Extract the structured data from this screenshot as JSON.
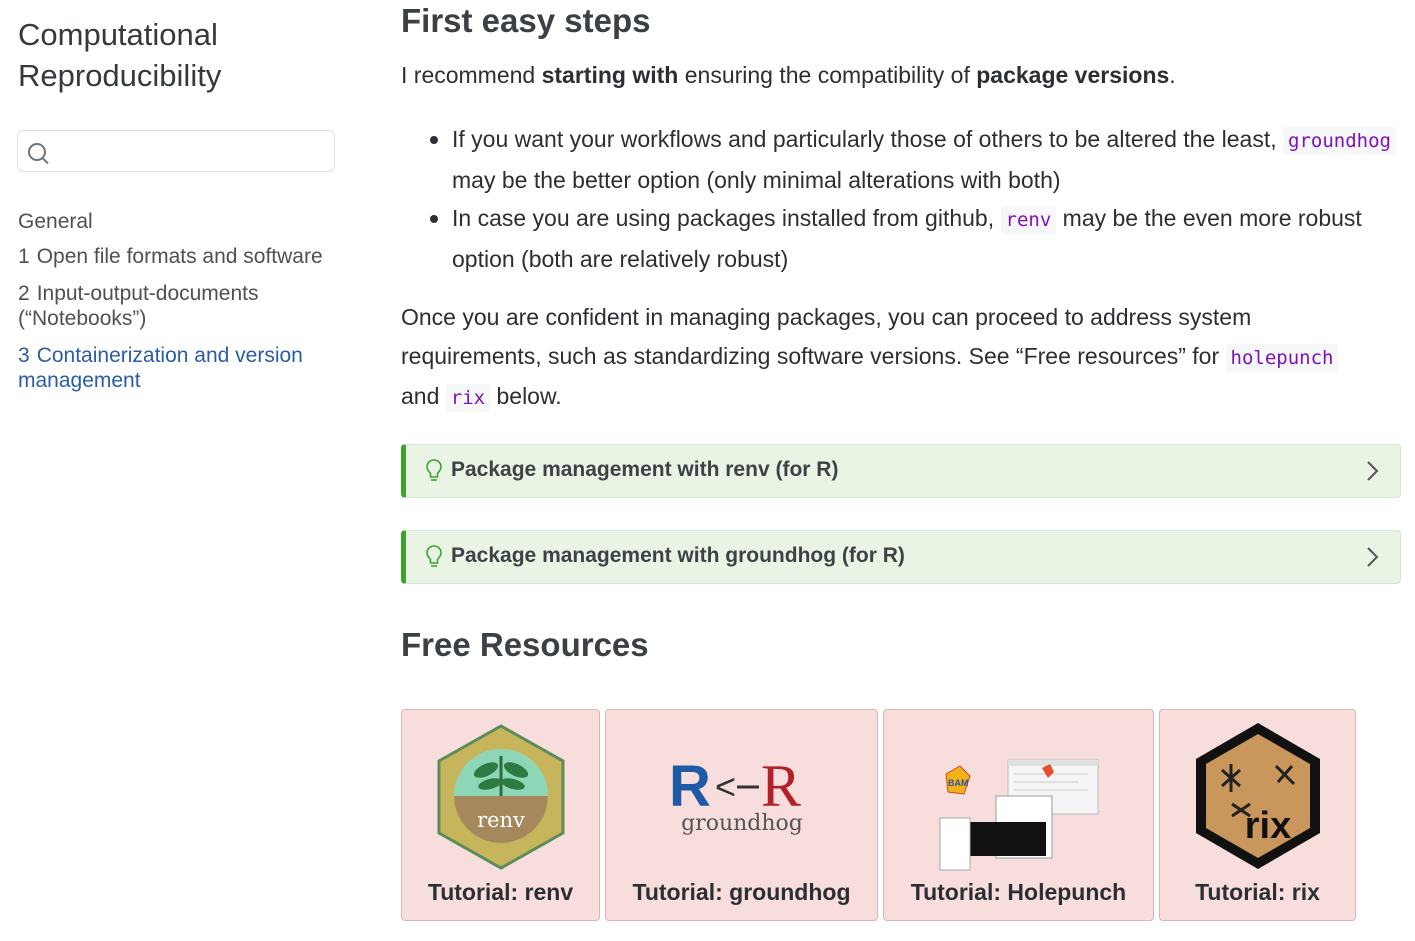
{
  "sidebar": {
    "site_title": "Computational Reproducibility",
    "search_placeholder": "",
    "section": "General",
    "items": [
      {
        "num": "1",
        "label": "Open file formats and software"
      },
      {
        "num": "2",
        "label": "Input-output-documents (“Notebooks”)"
      },
      {
        "num": "3",
        "label": "Containerization and version management",
        "active": true
      }
    ]
  },
  "main": {
    "heading": "First easy steps",
    "intro": {
      "pre": "I recommend ",
      "b1": "starting with",
      "mid": " ensuring the compatibility of ",
      "b2": "package versions",
      "post": "."
    },
    "bullets": [
      {
        "pre": "If you want your workflows and particularly those of others to be altered the least, ",
        "code": "groundhog",
        "post": " may be the better option (only minimal alterations with both)"
      },
      {
        "pre": "In case you are using packages installed from github, ",
        "code": "renv",
        "post": " may be the even more robust option (both are relatively robust)"
      }
    ],
    "para2": {
      "pre": "Once you are confident in managing packages, you can proceed to address system requirements, such as standardizing software versions. See “Free resources” for ",
      "code1": "holepunch",
      "mid": " and ",
      "code2": "rix",
      "post": " below."
    },
    "callouts": [
      {
        "title": "Package management with renv (for R)"
      },
      {
        "title": "Package management with groundhog (for R)"
      }
    ],
    "resources_heading": "Free Resources",
    "cards": [
      {
        "label": "Tutorial: renv",
        "logo_text": "renv"
      },
      {
        "label": "Tutorial: groundhog",
        "logo_text": "groundhog"
      },
      {
        "label": "Tutorial: Holepunch"
      },
      {
        "label": "Tutorial: rix",
        "logo_text": "rix"
      }
    ]
  },
  "colors": {
    "callout_border": "#3aa42f",
    "callout_bg": "#e9f4e4",
    "card_bg": "#f7dedc",
    "link": "#2a5ca8",
    "code": "#7d12ba"
  }
}
